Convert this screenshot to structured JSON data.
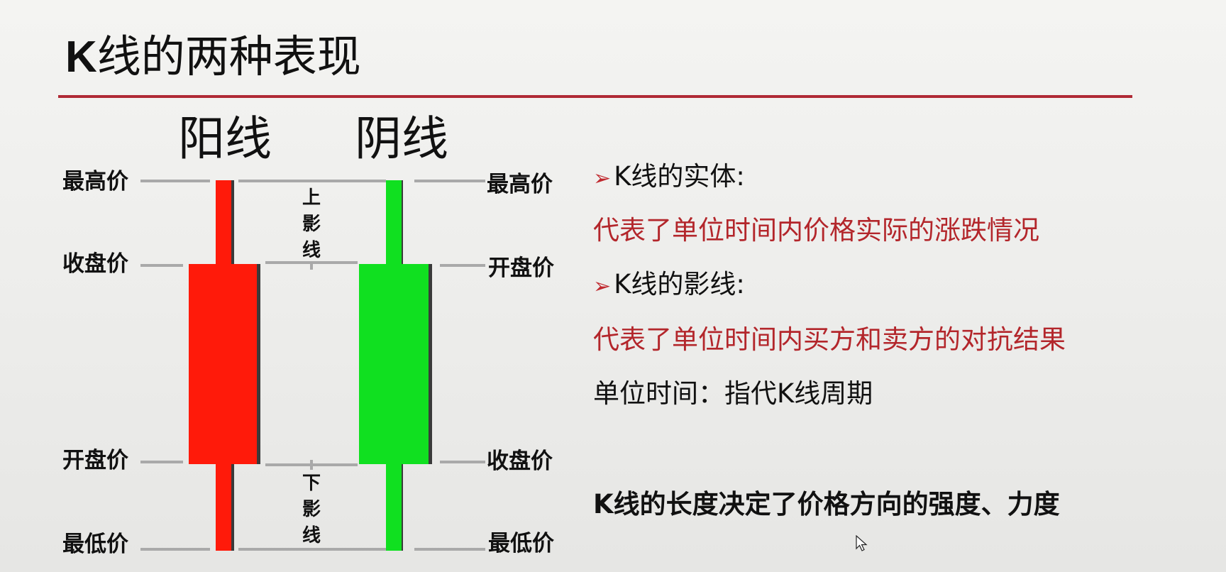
{
  "title": {
    "prefix": "K",
    "rest": "线的两种表现"
  },
  "candles": {
    "yang": {
      "name": "阳线",
      "color": "#ff1a0a",
      "labels": {
        "top": "最高价",
        "body_top": "收盘价",
        "body_bottom": "开盘价",
        "bottom": "最低价"
      }
    },
    "yin": {
      "name": "阴线",
      "color": "#10e020",
      "labels": {
        "top": "最高价",
        "body_top": "开盘价",
        "body_bottom": "收盘价",
        "bottom": "最低价"
      }
    },
    "upper_shadow": [
      "上",
      "影",
      "线"
    ],
    "lower_shadow": [
      "下",
      "影",
      "线"
    ]
  },
  "notes": {
    "entity_heading": "K线的实体:",
    "entity_desc": "代表了单位时间内价格实际的涨跌情况",
    "shadow_heading": "K线的影线:",
    "shadow_desc": "代表了单位时间内买方和卖方的对抗结果",
    "unit_time": "单位时间：指代K线周期",
    "length_prefix": "K",
    "length_rest": "线的长度决定了价格方向的强度、力度"
  },
  "colors": {
    "accent_red": "#b3262b",
    "rule": "#b02a35",
    "bullet": "#c0282e"
  },
  "icons": {
    "bullet": "arrow-bullet-icon",
    "cursor": "mouse-cursor-icon"
  }
}
